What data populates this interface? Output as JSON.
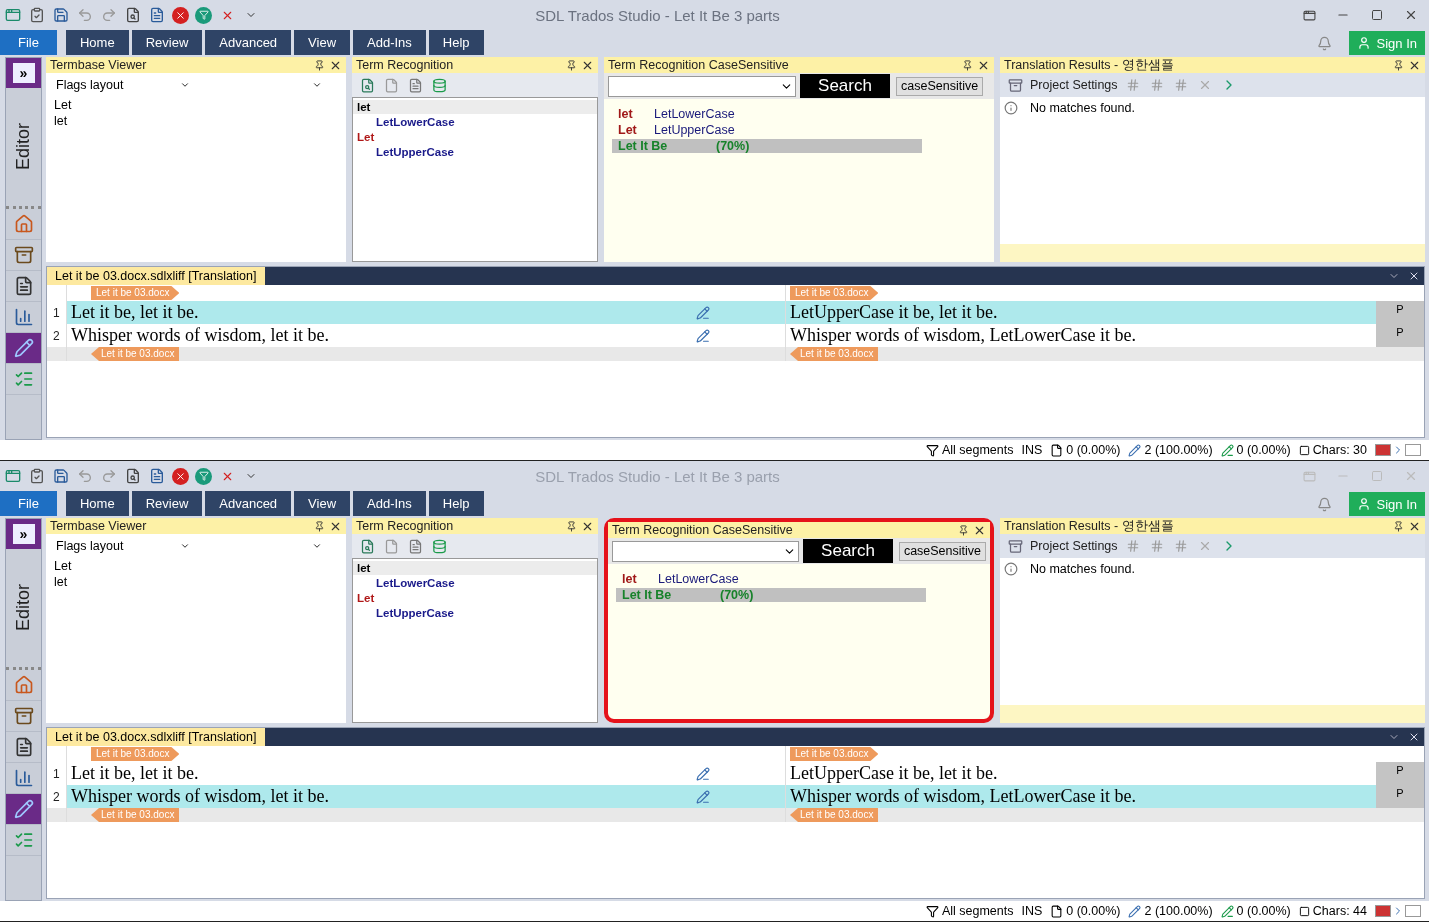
{
  "windows": [
    {
      "active": true,
      "title": "SDL Trados Studio - Let It Be 3 parts",
      "ribbon_tabs": [
        {
          "label": "File",
          "kind": "file"
        },
        {
          "label": "Home",
          "kind": "tab"
        },
        {
          "label": "Review",
          "kind": "tab"
        },
        {
          "label": "Advanced",
          "kind": "tab"
        },
        {
          "label": "View",
          "kind": "tab"
        },
        {
          "label": "Add-Ins",
          "kind": "tab"
        },
        {
          "label": "Help",
          "kind": "tab"
        }
      ],
      "sign_in": "Sign In",
      "nav": {
        "expand": "»",
        "label": "Editor",
        "items": [
          {
            "kind": "home",
            "selected": false
          },
          {
            "kind": "drawer",
            "selected": false
          },
          {
            "kind": "document",
            "selected": false
          },
          {
            "kind": "chart",
            "selected": false
          },
          {
            "kind": "pencil",
            "selected": true
          },
          {
            "kind": "list",
            "selected": false
          }
        ]
      },
      "termbase_viewer": {
        "title": "Termbase Viewer",
        "layout": "Flags layout",
        "entries": [
          "Let",
          "let"
        ]
      },
      "term_recognition": {
        "title": "Term Recognition",
        "terms": [
          {
            "text": "let",
            "selected": true,
            "children": [
              {
                "text": "LetLowerCase"
              }
            ]
          },
          {
            "text": "Let",
            "selected": false,
            "children": [
              {
                "text": "LetUpperCase"
              }
            ]
          }
        ]
      },
      "case_sensitive": {
        "title": "Term Recognition CaseSensitive",
        "highlighted": false,
        "search_button": "Search",
        "option_button": "caseSensitive",
        "results": [
          {
            "kind": "term",
            "source": "let",
            "target": "LetLowerCase"
          },
          {
            "kind": "term",
            "source": "Let",
            "target": "LetUpperCase"
          },
          {
            "kind": "fragment",
            "source": "Let It Be",
            "target": "(70%)"
          }
        ]
      },
      "translation_results": {
        "title": "Translation Results - 영한샘플",
        "project_settings": "Project Settings",
        "message": "No matches found."
      },
      "editor": {
        "tab": "Let it be  03.docx.sdlxliff [Translation]",
        "source_open_tag": "Let it be 03.docx",
        "source_close_tag": "Let it be 03.docx",
        "target_open_tag": "Let it be 03.docx",
        "target_close_tag": "Let it be 03.docx",
        "segments": [
          {
            "number": "1",
            "source": "Let it be, let it be.",
            "target": "LetUpperCase it be, let it be.",
            "status": "P",
            "active": true
          },
          {
            "number": "2",
            "source": "Whisper words of wisdom, let it be.",
            "target": "Whisper words of wisdom, LetLowerCase it be.",
            "status": "P",
            "active": false
          }
        ]
      },
      "status_bar": {
        "filter": "All segments",
        "mode": "INS",
        "not_translated": "0 (0.00%)",
        "draft": "2 (100.00%)",
        "translated": "0 (0.00%)",
        "chars": "Chars: 30"
      }
    },
    {
      "active": false,
      "title": "SDL Trados Studio - Let It Be 3 parts",
      "ribbon_tabs": [
        {
          "label": "File",
          "kind": "file"
        },
        {
          "label": "Home",
          "kind": "tab"
        },
        {
          "label": "Review",
          "kind": "tab"
        },
        {
          "label": "Advanced",
          "kind": "tab"
        },
        {
          "label": "View",
          "kind": "tab"
        },
        {
          "label": "Add-Ins",
          "kind": "tab"
        },
        {
          "label": "Help",
          "kind": "tab"
        }
      ],
      "sign_in": "Sign In",
      "nav": {
        "expand": "»",
        "label": "Editor",
        "items": [
          {
            "kind": "home",
            "selected": false
          },
          {
            "kind": "drawer",
            "selected": false
          },
          {
            "kind": "document",
            "selected": false
          },
          {
            "kind": "chart",
            "selected": false
          },
          {
            "kind": "pencil",
            "selected": true
          },
          {
            "kind": "list",
            "selected": false
          }
        ]
      },
      "termbase_viewer": {
        "title": "Termbase Viewer",
        "layout": "Flags layout",
        "entries": [
          "Let",
          "let"
        ]
      },
      "term_recognition": {
        "title": "Term Recognition",
        "terms": [
          {
            "text": "let",
            "selected": true,
            "children": [
              {
                "text": "LetLowerCase"
              }
            ]
          },
          {
            "text": "Let",
            "selected": false,
            "children": [
              {
                "text": "LetUpperCase"
              }
            ]
          }
        ]
      },
      "case_sensitive": {
        "title": "Term Recognition CaseSensitive",
        "highlighted": true,
        "search_button": "Search",
        "option_button": "caseSensitive",
        "results": [
          {
            "kind": "term",
            "source": "let",
            "target": "LetLowerCase"
          },
          {
            "kind": "fragment",
            "source": "Let It Be",
            "target": "(70%)"
          }
        ]
      },
      "translation_results": {
        "title": "Translation Results - 영한샘플",
        "project_settings": "Project Settings",
        "message": "No matches found."
      },
      "editor": {
        "tab": "Let it be  03.docx.sdlxliff [Translation]",
        "source_open_tag": "Let it be 03.docx",
        "source_close_tag": "Let it be 03.docx",
        "target_open_tag": "Let it be 03.docx",
        "target_close_tag": "Let it be 03.docx",
        "segments": [
          {
            "number": "1",
            "source": "Let it be, let it be.",
            "target": "LetUpperCase it be, let it be.",
            "status": "P",
            "active": false
          },
          {
            "number": "2",
            "source": "Whisper words of wisdom, let it be.",
            "target": "Whisper words of wisdom, LetLowerCase it be.",
            "status": "P",
            "active": true
          }
        ]
      },
      "status_bar": {
        "filter": "All segments",
        "mode": "INS",
        "not_translated": "0 (0.00%)",
        "draft": "2 (100.00%)",
        "translated": "0 (0.00%)",
        "chars": "Chars: 44"
      }
    }
  ]
}
